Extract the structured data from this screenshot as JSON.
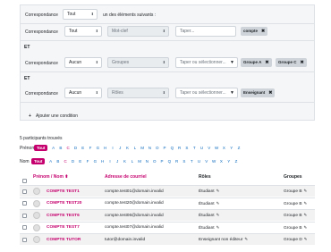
{
  "filter": {
    "header": {
      "label": "Correspondance",
      "match_value": "Tout",
      "suffix": "un des éléments suivants :"
    },
    "rows": [
      {
        "label": "Correspondance",
        "match": "Tout",
        "field": "Mot-clef",
        "input": "Taper...",
        "tags": [
          "compte"
        ]
      },
      {
        "label": "Correspondance",
        "match": "Aucun",
        "field": "Groupes",
        "input": "Taper ou sélectionner...",
        "tags": [
          "Groupe A",
          "Groupe C"
        ]
      },
      {
        "label": "Correspondance",
        "match": "Aucun",
        "field": "Rôles",
        "input": "Taper ou sélectionner...",
        "tags": [
          "Enseignant"
        ]
      }
    ],
    "and_label": "ET",
    "add_condition": "Ajouter une condition"
  },
  "participants_count": "5 participants trouvés",
  "prenom_bar": {
    "label": "Prénom",
    "all": "Tout",
    "letters": [
      "A",
      "B",
      "C",
      "D",
      "E",
      "F",
      "G",
      "H",
      "I",
      "J",
      "K",
      "L",
      "M",
      "N",
      "O",
      "P",
      "Q",
      "R",
      "S",
      "T",
      "U",
      "V",
      "W",
      "X",
      "Y",
      "Z"
    ]
  },
  "nom_bar": {
    "label": "Nom",
    "all": "Tout",
    "letters": [
      "A",
      "B",
      "C",
      "D",
      "E",
      "F",
      "G",
      "H",
      "I",
      "J",
      "K",
      "L",
      "M",
      "N",
      "O",
      "P",
      "Q",
      "R",
      "S",
      "T",
      "U",
      "V",
      "W",
      "X",
      "Y",
      "Z"
    ]
  },
  "table": {
    "headers": {
      "name": "Prénom / Nom",
      "email": "Adresse de courriel",
      "roles": "Rôles",
      "groups": "Groupes"
    },
    "rows": [
      {
        "name": "COMPTE TEST1",
        "email": "compte.test01@domain.invalid",
        "role": "Étudiant",
        "group": "Groupe B"
      },
      {
        "name": "COMPTE TEST20",
        "email": "compte.test20@domain.invalid",
        "role": "Étudiant",
        "group": "Groupe B"
      },
      {
        "name": "COMPTE TEST6",
        "email": "compte.test06@domain.invalid",
        "role": "Étudiant",
        "group": "Groupe B"
      },
      {
        "name": "COMPTE TEST7",
        "email": "compte.test07@domain.invalid",
        "role": "Étudiant",
        "group": "Groupe B"
      },
      {
        "name": "COMPTE TUTOR",
        "email": "tutor@domain.invalid",
        "role": "Enseignant non éditeur",
        "group": "Groupe D"
      }
    ]
  },
  "colors": {
    "accent": "#c5006e",
    "panel_bg": "#f5f6f7",
    "tag_bg": "#ced4da"
  }
}
